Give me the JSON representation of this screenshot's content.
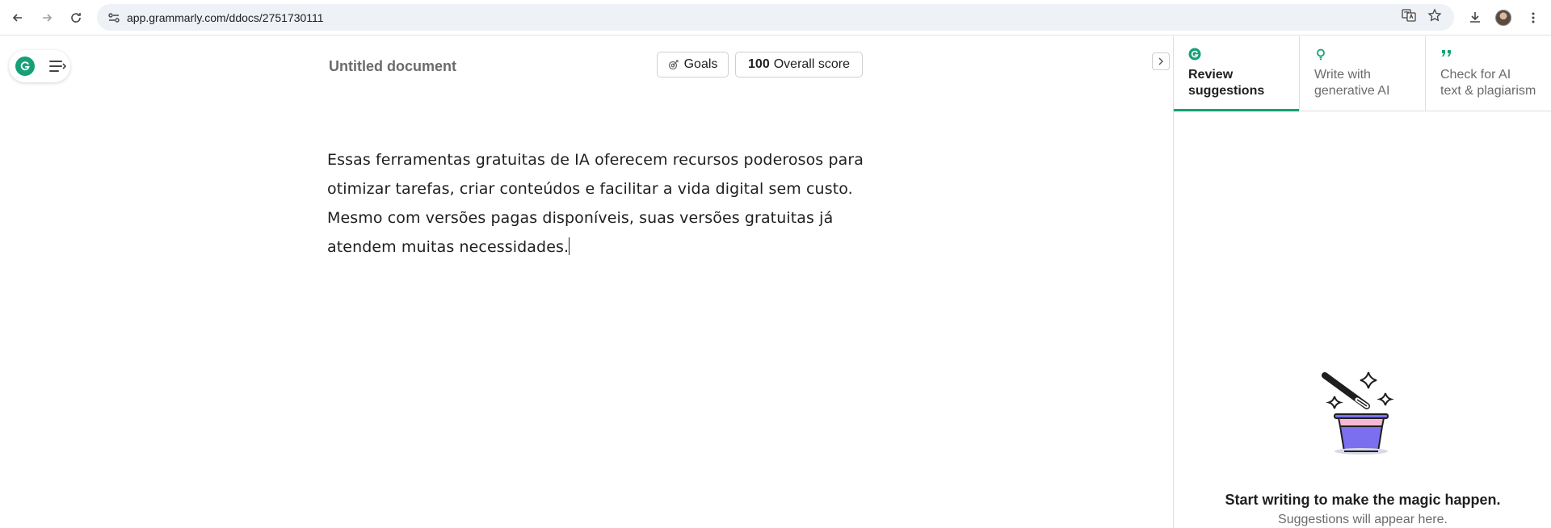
{
  "browser": {
    "url": "app.grammarly.com/ddocs/2751730111"
  },
  "header": {
    "doc_title": "Untitled document",
    "goals_label": "Goals",
    "score_value": "100",
    "score_label": "Overall score"
  },
  "document": {
    "lines": [
      "Essas ferramentas gratuitas de IA oferecem recursos poderosos para",
      "otimizar tarefas, criar conteúdos e facilitar a vida digital sem custo.",
      "Mesmo com versões pagas disponíveis, suas versões gratuitas já",
      "atendem muitas necessidades."
    ]
  },
  "panel": {
    "tabs": [
      {
        "label_line1": "Review",
        "label_line2": "suggestions",
        "icon": "grammarly-g-icon",
        "active": true
      },
      {
        "label_line1": "Write with",
        "label_line2": "generative AI",
        "icon": "lightbulb-icon",
        "active": false
      },
      {
        "label_line1": "Check for AI",
        "label_line2": "text & plagiarism",
        "icon": "quote-icon",
        "active": false
      }
    ],
    "empty_title": "Start writing to make the magic happen.",
    "empty_subtitle": "Suggestions will appear here."
  },
  "colors": {
    "accent": "#15a076",
    "hat": "#7b6ff0",
    "hat_band": "#f4b8d4"
  }
}
